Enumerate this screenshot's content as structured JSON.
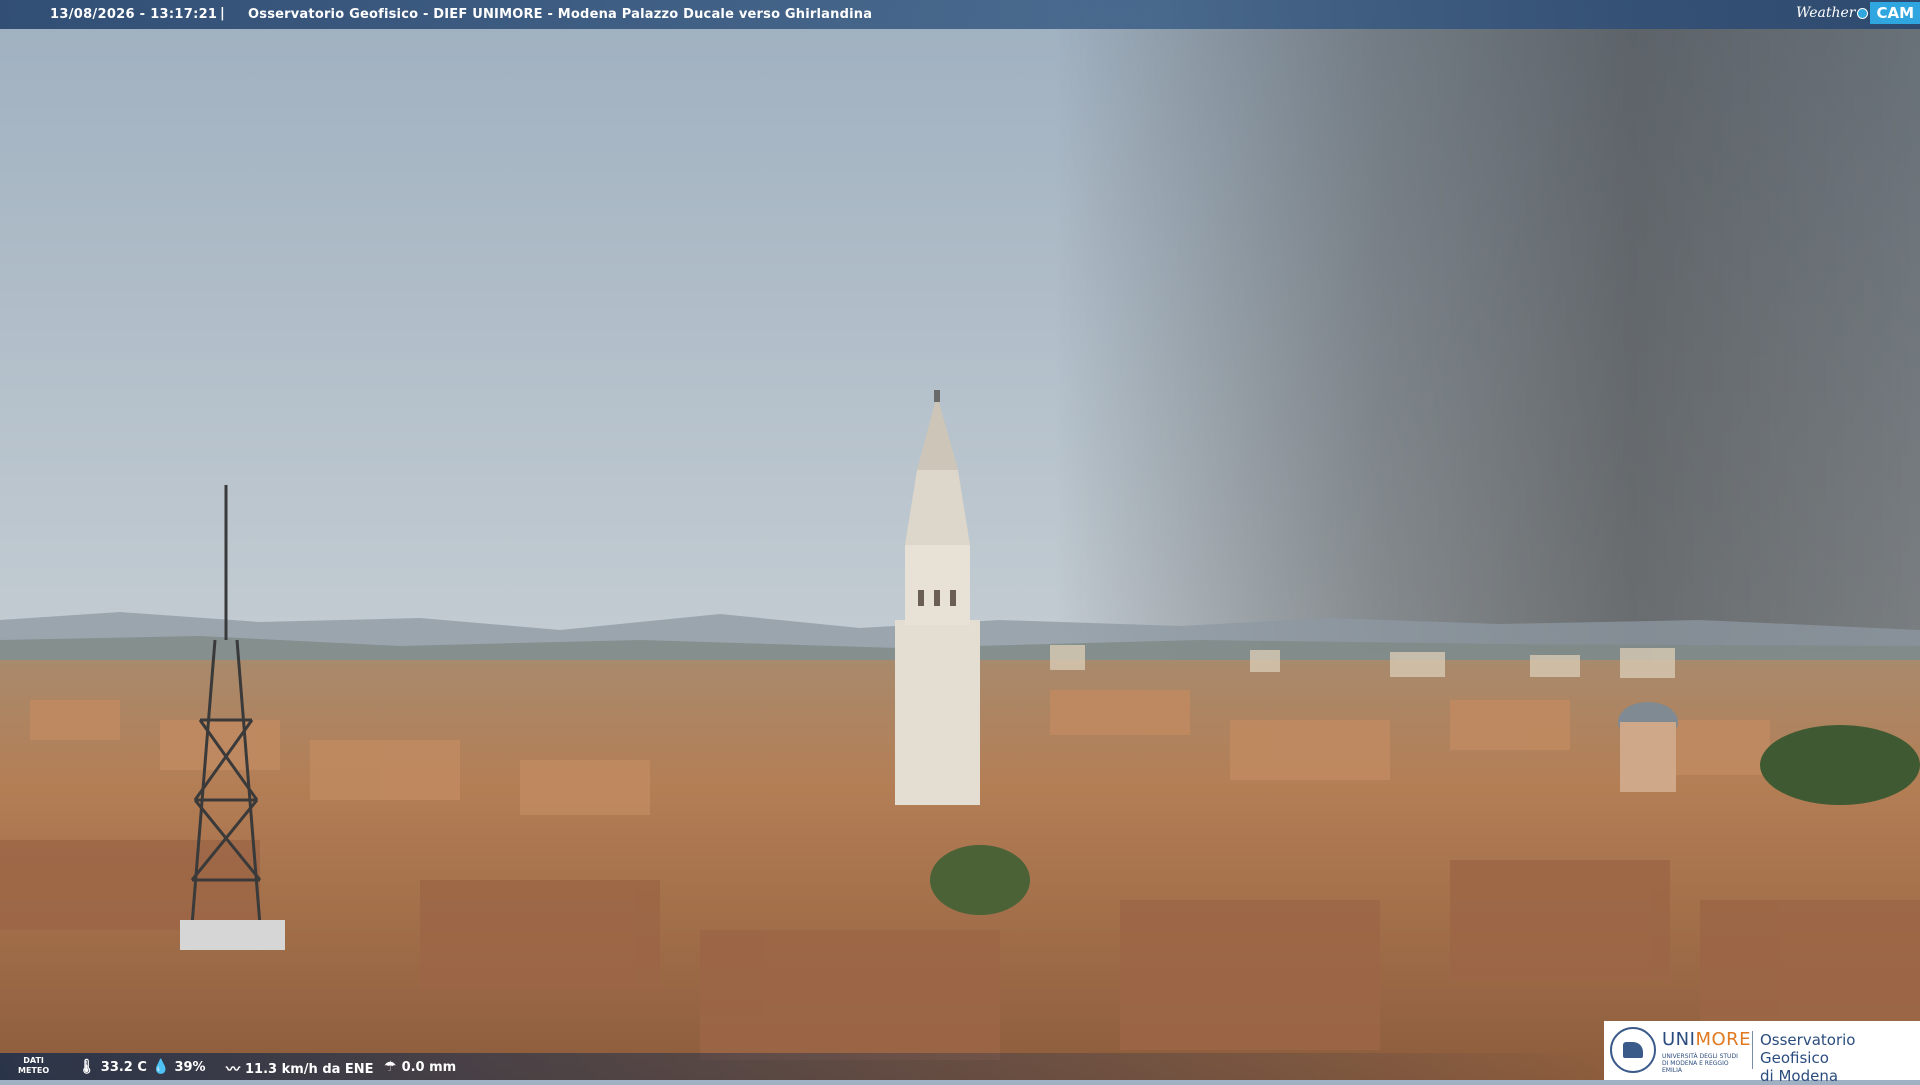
{
  "header": {
    "datetime": "13/08/2026 - 13:17:21",
    "separator": "|",
    "title": "Osservatorio Geofisico - DIEF UNIMORE - Modena Palazzo Ducale verso Ghirlandina"
  },
  "brand_logo": {
    "weather": "Weather",
    "cam": "CAM"
  },
  "weather_bar": {
    "dati_label_1": "DATI",
    "dati_label_2": "METEO",
    "temperature": "33.2 C",
    "humidity": "39%",
    "wind": "11.3 km/h da ENE",
    "rain": "0.0 mm"
  },
  "icons": {
    "temperature": "thermometer-icon",
    "humidity": "droplet-icon",
    "wind": "wind-icon",
    "rain": "rain-gauge-icon"
  },
  "unimore_logo": {
    "brand_uni": "UNI",
    "brand_more": "MORE",
    "brand_sub": "UNIVERSITÀ DEGLI STUDI DI MODENA E REGGIO EMILIA",
    "observatory_line1": "Osservatorio Geofisico",
    "observatory_line2": "di Modena"
  },
  "colors": {
    "sky_top": "#a6b4c2",
    "sky_horizon": "#d8dcd8",
    "roofs": "#b9835a",
    "topbar": "#284670",
    "accent_cam": "#2fa6e0",
    "unimore_blue": "#2b4c7e",
    "unimore_orange": "#e07a22"
  }
}
